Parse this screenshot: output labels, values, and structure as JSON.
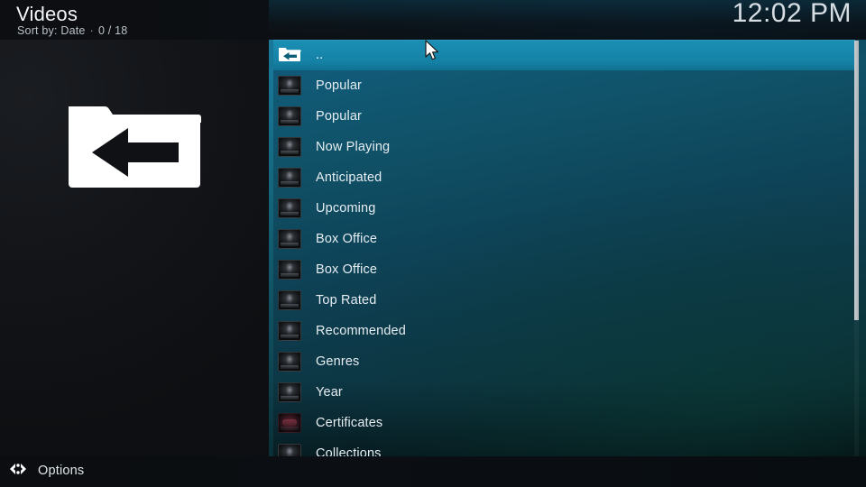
{
  "window": {
    "title": "Videos",
    "sort_label": "Sort by: Date",
    "separator": "·",
    "item_count": "0 / 18",
    "clock": "12:02 PM"
  },
  "header_icons": {
    "folder_art": "folder-back-icon"
  },
  "list": {
    "items": [
      {
        "label": "..",
        "icon": "parent-folder-icon",
        "selected": true,
        "icon_style": "folder"
      },
      {
        "label": "Popular",
        "icon": "poster-icon",
        "selected": false,
        "icon_style": "poster"
      },
      {
        "label": "Popular",
        "icon": "poster-icon",
        "selected": false,
        "icon_style": "poster"
      },
      {
        "label": "Now Playing",
        "icon": "poster-icon",
        "selected": false,
        "icon_style": "poster"
      },
      {
        "label": "Anticipated",
        "icon": "poster-icon",
        "selected": false,
        "icon_style": "poster"
      },
      {
        "label": "Upcoming",
        "icon": "poster-icon",
        "selected": false,
        "icon_style": "poster"
      },
      {
        "label": "Box Office",
        "icon": "poster-icon",
        "selected": false,
        "icon_style": "poster"
      },
      {
        "label": "Box Office",
        "icon": "poster-icon",
        "selected": false,
        "icon_style": "poster"
      },
      {
        "label": "Top Rated",
        "icon": "poster-icon",
        "selected": false,
        "icon_style": "poster"
      },
      {
        "label": "Recommended",
        "icon": "poster-icon",
        "selected": false,
        "icon_style": "poster"
      },
      {
        "label": "Genres",
        "icon": "poster-icon",
        "selected": false,
        "icon_style": "poster"
      },
      {
        "label": "Year",
        "icon": "poster-icon",
        "selected": false,
        "icon_style": "poster"
      },
      {
        "label": "Certificates",
        "icon": "poster-icon",
        "selected": false,
        "icon_style": "poster-red"
      },
      {
        "label": "Collections",
        "icon": "poster-icon",
        "selected": false,
        "icon_style": "poster"
      }
    ]
  },
  "footer": {
    "options_label": "Options",
    "options_icon": "left-right-arrows-icon"
  },
  "colors": {
    "selection": "#1887ac",
    "panel_top": "#115a78",
    "panel_bottom": "#07181b",
    "sidebar": "#131519",
    "text": "#e6edf1",
    "muted_text": "#b9c3c9",
    "scrollbar": "#c9ced2"
  }
}
